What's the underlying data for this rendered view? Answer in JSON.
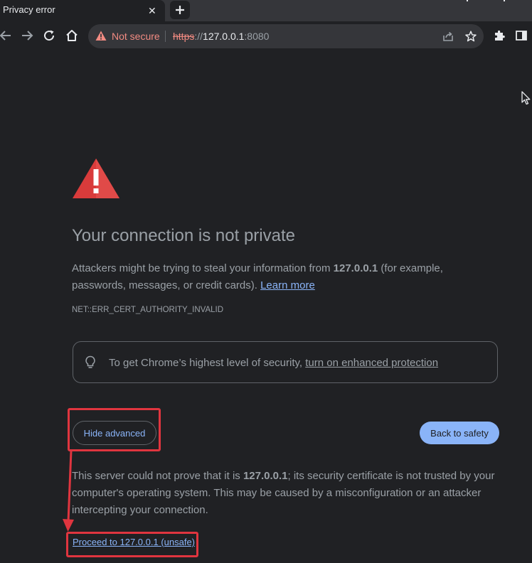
{
  "tab": {
    "title": "Privacy error",
    "close_glyph": "✕"
  },
  "toolbar": {
    "security_chip": "Not secure",
    "url_scheme": "https",
    "url_separator": "://",
    "url_host": "127.0.0.1",
    "url_port": ":8080"
  },
  "page": {
    "heading": "Your connection is not private",
    "body_pre": "Attackers might be trying to steal your information from ",
    "body_host": "127.0.0.1",
    "body_post": " (for example, passwords, messages, or credit cards). ",
    "learn_more": "Learn more",
    "error_code": "NET::ERR_CERT_AUTHORITY_INVALID",
    "enhanced_pre": "To get Chrome’s highest level of security, ",
    "enhanced_link": "turn on enhanced protection",
    "hide_advanced": "Hide advanced",
    "back_to_safety": "Back to safety",
    "details_pre": "This server could not prove that it is ",
    "details_host": "127.0.0.1",
    "details_post": "; its security certificate is not trusted by your computer's operating system. This may be caused by a misconfiguration or an attacker intercepting your connection.",
    "proceed": "Proceed to 127.0.0.1 (unsafe)"
  },
  "colors": {
    "background": "#202124",
    "text": "#9aa0a6",
    "link": "#8ab4f8",
    "warning_red": "#f28b82",
    "annotation_red": "#e0353f"
  },
  "icons": {
    "back": "arrow-left-icon",
    "forward": "arrow-right-icon",
    "reload": "reload-icon",
    "home": "home-icon",
    "warning": "warning-triangle-icon",
    "share": "share-icon",
    "bookmark": "star-icon",
    "extensions": "puzzle-icon",
    "side_panel": "side-panel-icon",
    "bulb": "lightbulb-icon"
  }
}
